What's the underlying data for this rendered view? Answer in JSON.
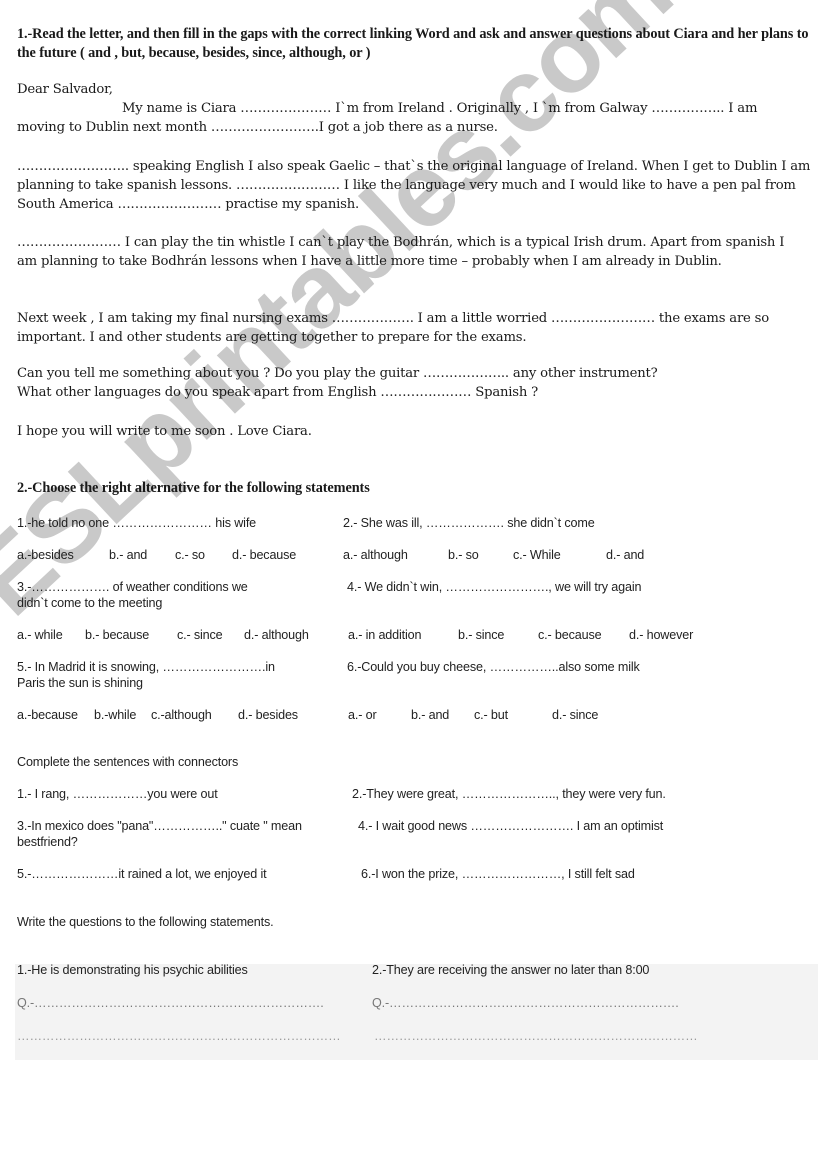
{
  "watermark": "ESLprintables.com",
  "section1": {
    "title": "1.-Read the letter, and then fill in the gaps with the correct linking Word and ask and answer questions about Ciara  and her plans to the future ( and , but, because, besides, since, although, or )",
    "salutation": "Dear  Salvador,",
    "p1_line1": "My name is Ciara ………………… I`m from Ireland . Originally , I `m from Galway …………….. I am",
    "p1_line2": "moving to Dublin next month …………………….I got a job there as a  nurse.",
    "p2": "…………………….. speaking English I also speak Gaelic – that`s the original language of Ireland. When I get to Dublin I am planning to take spanish lessons.  …………………… I like the language very much and I would like to have a pen pal from South America …………………… practise my spanish.",
    "p3": "…………………… I can play the tin whistle I can`t play the Bodhrán, which is a typical Irish drum. Apart from spanish I am planning to take  Bodhrán lessons when I have a little more time – probably when I am already in Dublin.",
    "p4": "Next week , I am taking my final nursing exams ………………. I am a little worried ……………………   the exams are so important. I and other students are getting together to prepare for the exams.",
    "p5_line1": "Can you tell me something about you ?  Do you play the guitar ……………….. any other instrument?",
    "p5_line2": "What other languages do you speak apart from English ………………… Spanish ?",
    "closing": "I hope you will write to me soon .      Love  Ciara."
  },
  "section2": {
    "title": "2.-Choose the right alternative for the following statements",
    "items": [
      {
        "q1": "1.-he told no one …………………… his wife",
        "q2": "2.-  She  was ill, ………………. she didn`t come",
        "opts1": [
          "a.-besides",
          "b.-  and",
          "c.- so",
          "d.- because"
        ],
        "opts2": [
          "a.- although",
          "b.- so",
          "c.- While",
          "d.- and"
        ]
      },
      {
        "q1": "3.-………………. of weather conditions we",
        "q1b": "didn`t come  to the meeting",
        "q2": "4.- We didn`t win, ……………………., we will try again",
        "opts1": [
          "a.- while",
          "b.- because",
          "c.- since",
          "d.- although"
        ],
        "opts2": [
          "a.-  in addition",
          "b.-  since",
          "c.- because",
          "d.- however"
        ]
      },
      {
        "q1": "5.- In Madrid it is snowing, …………………….in",
        "q1b": " Paris the sun is shining",
        "q2": "6.-Could you buy cheese, ……………..also some milk",
        "opts1": [
          "a.-because",
          "b.-while",
          "c.-although",
          "d.- besides"
        ],
        "opts2": [
          "a.- or",
          "b.- and",
          "c.- but",
          "d.- since"
        ]
      }
    ]
  },
  "section3": {
    "title": "Complete the sentences with connectors",
    "s1": "1.- I rang, ………………you were out",
    "s2": "2.-They were great, ………………….., they were very fun.",
    "s3": "3.-In mexico does \"pana\"……………..\" cuate \" mean",
    "s3b": "bestfriend?",
    "s4": "4.- I wait good news ……………………. I am an optimist",
    "s5": "5.-…………………it rained a lot, we enjoyed it",
    "s6": "6.-I won the prize, ……………………, I still felt sad"
  },
  "section4": {
    "title": "Write the questions to the following statements.",
    "st1": "1.-He is demonstrating his psychic abilities",
    "st2": "2.-They are receiving the answer no later than 8:00",
    "q1": "Q.-…………………………………………………………….",
    "q2": "Q.-…………………………………………………………….",
    "line1": "……………………………………………………………………",
    "line2": "……………………………………………………………………"
  }
}
